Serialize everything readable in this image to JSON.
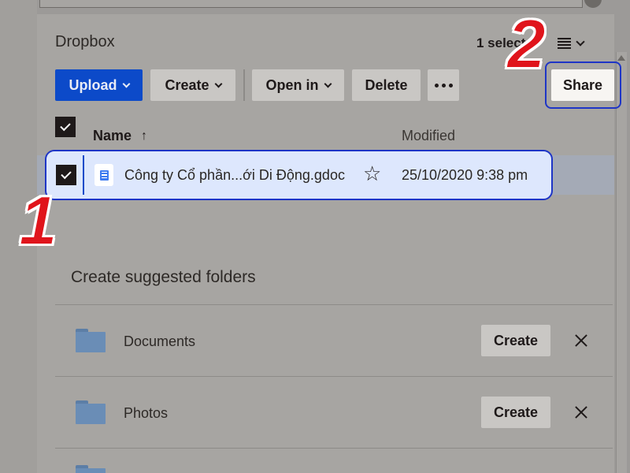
{
  "header": {
    "title": "Dropbox",
    "selected_count": "1 selected"
  },
  "toolbar": {
    "upload_label": "Upload",
    "create_label": "Create",
    "open_in_label": "Open in",
    "delete_label": "Delete",
    "share_label": "Share"
  },
  "table": {
    "columns": {
      "name": "Name",
      "modified": "Modified"
    },
    "sort_arrow": "↑",
    "rows": [
      {
        "name": "Công ty Cổ phần...ới Di Động.gdoc",
        "modified": "25/10/2020 9:38 pm",
        "selected": true
      }
    ]
  },
  "suggested": {
    "title": "Create suggested folders",
    "folders": [
      {
        "name": "Documents",
        "create_label": "Create"
      },
      {
        "name": "Photos",
        "create_label": "Create"
      }
    ]
  },
  "annotations": {
    "step1": "1",
    "step2": "2"
  },
  "colors": {
    "accent": "#0c4ac9",
    "highlight": "#1e35c6",
    "marker": "#e0141b"
  }
}
